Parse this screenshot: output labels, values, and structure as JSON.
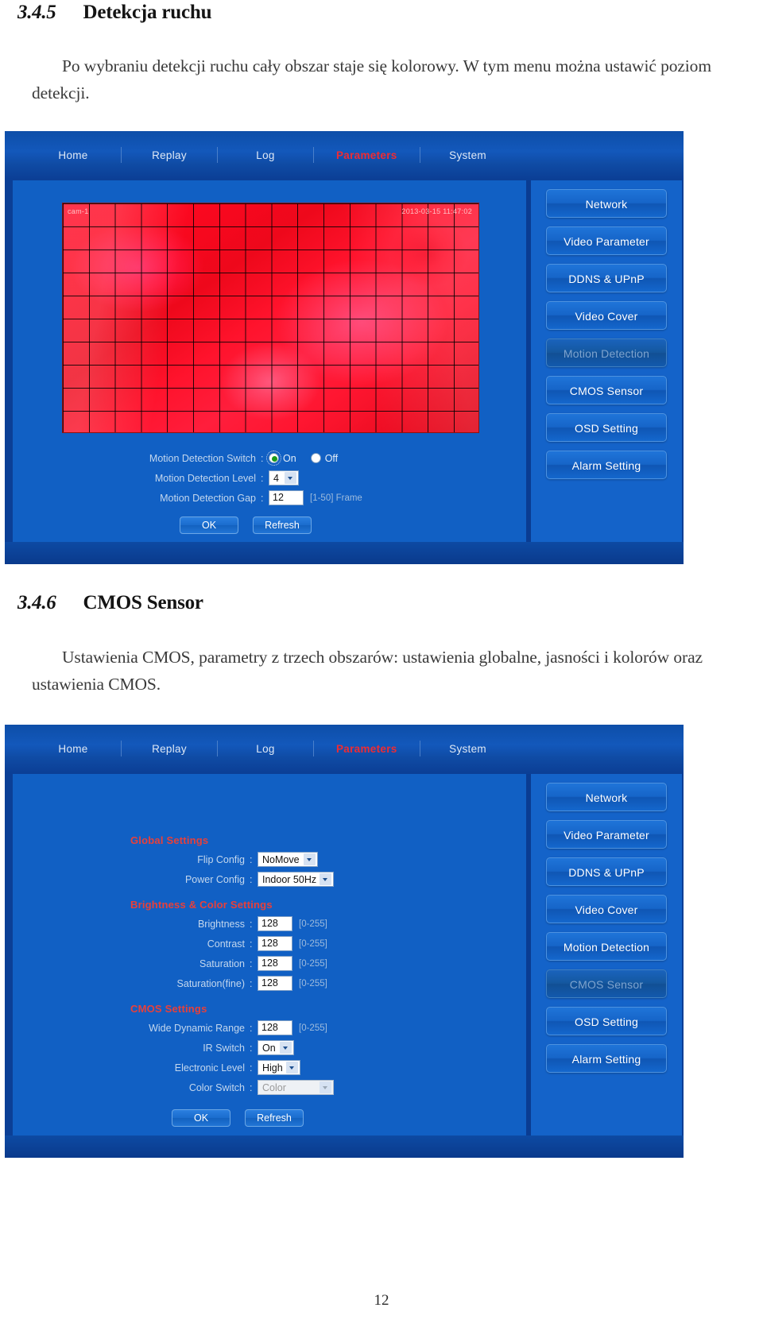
{
  "document": {
    "page_number": "12",
    "section_345": {
      "number": "3.4.5",
      "title": "Detekcja ruchu",
      "paragraph": "Po wybraniu detekcji ruchu cały obszar staje się kolorowy. W tym menu można ustawić poziom detekcji."
    },
    "section_346": {
      "number": "3.4.6",
      "title": "CMOS Sensor",
      "paragraph": "Ustawienia CMOS, parametry z trzech obszarów: ustawienia globalne, jasności i kolorów oraz ustawienia CMOS."
    }
  },
  "colors": {
    "nav_active": "#ef2b33",
    "group_title": "#e8403a",
    "panel_bg": "#1160c4",
    "button_face": "#1665c8",
    "motion_overlay": "#e01b1b"
  },
  "screenshot_motion": {
    "nav": {
      "items": [
        {
          "label": "Home",
          "active": false
        },
        {
          "label": "Replay",
          "active": false
        },
        {
          "label": "Log",
          "active": false
        },
        {
          "label": "Parameters",
          "active": true
        },
        {
          "label": "System",
          "active": false
        }
      ]
    },
    "preview": {
      "osd_left": "cam-1",
      "osd_right": "2013-03-15 11:47:02"
    },
    "menu": [
      {
        "label": "Network",
        "active": false
      },
      {
        "label": "Video Parameter",
        "active": false
      },
      {
        "label": "DDNS & UPnP",
        "active": false
      },
      {
        "label": "Video Cover",
        "active": false
      },
      {
        "label": "Motion Detection",
        "active": true
      },
      {
        "label": "CMOS Sensor",
        "active": false
      },
      {
        "label": "OSD Setting",
        "active": false
      },
      {
        "label": "Alarm Setting",
        "active": false
      }
    ],
    "form": {
      "switch_label": "Motion Detection Switch",
      "switch_on_label": "On",
      "switch_off_label": "Off",
      "switch_value": "On",
      "level_label": "Motion Detection Level",
      "level_value": "4",
      "gap_label": "Motion Detection Gap",
      "gap_value": "12",
      "gap_hint": "[1-50] Frame",
      "ok_label": "OK",
      "refresh_label": "Refresh"
    }
  },
  "screenshot_cmos": {
    "nav": {
      "items": [
        {
          "label": "Home",
          "active": false
        },
        {
          "label": "Replay",
          "active": false
        },
        {
          "label": "Log",
          "active": false
        },
        {
          "label": "Parameters",
          "active": true
        },
        {
          "label": "System",
          "active": false
        }
      ]
    },
    "menu": [
      {
        "label": "Network",
        "active": false
      },
      {
        "label": "Video Parameter",
        "active": false
      },
      {
        "label": "DDNS & UPnP",
        "active": false
      },
      {
        "label": "Video Cover",
        "active": false
      },
      {
        "label": "Motion Detection",
        "active": false
      },
      {
        "label": "CMOS Sensor",
        "active": true
      },
      {
        "label": "OSD Setting",
        "active": false
      },
      {
        "label": "Alarm Setting",
        "active": false
      }
    ],
    "form": {
      "global_title": "Global Settings",
      "flip_label": "Flip Config",
      "flip_value": "NoMove",
      "power_label": "Power Config",
      "power_value": "Indoor 50Hz",
      "bright_title": "Brightness & Color Settings",
      "brightness_label": "Brightness",
      "brightness_value": "128",
      "brightness_hint": "[0-255]",
      "contrast_label": "Contrast",
      "contrast_value": "128",
      "contrast_hint": "[0-255]",
      "saturation_label": "Saturation",
      "saturation_value": "128",
      "saturation_hint": "[0-255]",
      "saturation_fine_label": "Saturation(fine)",
      "saturation_fine_value": "128",
      "saturation_fine_hint": "[0-255]",
      "cmos_title": "CMOS Settings",
      "wdr_label": "Wide Dynamic Range",
      "wdr_value": "128",
      "wdr_hint": "[0-255]",
      "ir_label": "IR Switch",
      "ir_value": "On",
      "elevel_label": "Electronic Level",
      "elevel_value": "High",
      "colorsw_label": "Color Switch",
      "colorsw_value": "Color",
      "ok_label": "OK",
      "refresh_label": "Refresh"
    }
  }
}
